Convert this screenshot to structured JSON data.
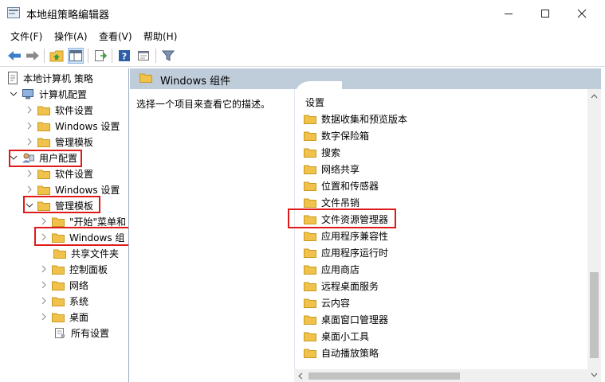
{
  "window": {
    "title": "本地组策略编辑器"
  },
  "menu": [
    "文件(F)",
    "操作(A)",
    "查看(V)",
    "帮助(H)"
  ],
  "tree": [
    {
      "label": "本地计算机 策略",
      "icon": "policy-doc-icon"
    },
    {
      "label": "计算机配置",
      "icon": "computer-icon"
    },
    {
      "label": "软件设置",
      "icon": "folder-icon"
    },
    {
      "label": "Windows 设置",
      "icon": "folder-icon"
    },
    {
      "label": "管理模板",
      "icon": "folder-icon"
    },
    {
      "label": "用户配置",
      "icon": "user-icon"
    },
    {
      "label": "软件设置",
      "icon": "folder-icon"
    },
    {
      "label": "Windows 设置",
      "icon": "folder-icon"
    },
    {
      "label": "管理模板",
      "icon": "folder-icon"
    },
    {
      "label": "\"开始\"菜单和",
      "icon": "folder-icon"
    },
    {
      "label": "Windows 组",
      "icon": "folder-icon"
    },
    {
      "label": "共享文件夹",
      "icon": "folder-icon"
    },
    {
      "label": "控制面板",
      "icon": "folder-icon"
    },
    {
      "label": "网络",
      "icon": "folder-icon"
    },
    {
      "label": "系统",
      "icon": "folder-icon"
    },
    {
      "label": "桌面",
      "icon": "folder-icon"
    },
    {
      "label": "所有设置",
      "icon": "settings-page-icon"
    }
  ],
  "right": {
    "header": "Windows 组件",
    "description": "选择一个项目来查看它的描述。",
    "column_header": "设置",
    "items": [
      "数据收集和预览版本",
      "数字保险箱",
      "搜索",
      "网络共享",
      "位置和传感器",
      "文件吊销",
      "文件资源管理器",
      "应用程序兼容性",
      "应用程序运行时",
      "应用商店",
      "远程桌面服务",
      "云内容",
      "桌面窗口管理器",
      "桌面小工具",
      "自动播放策略"
    ]
  },
  "colors": {
    "highlight": "#e01a1a",
    "header_bg": "#bfcddb",
    "folder": "#f0c24b"
  }
}
